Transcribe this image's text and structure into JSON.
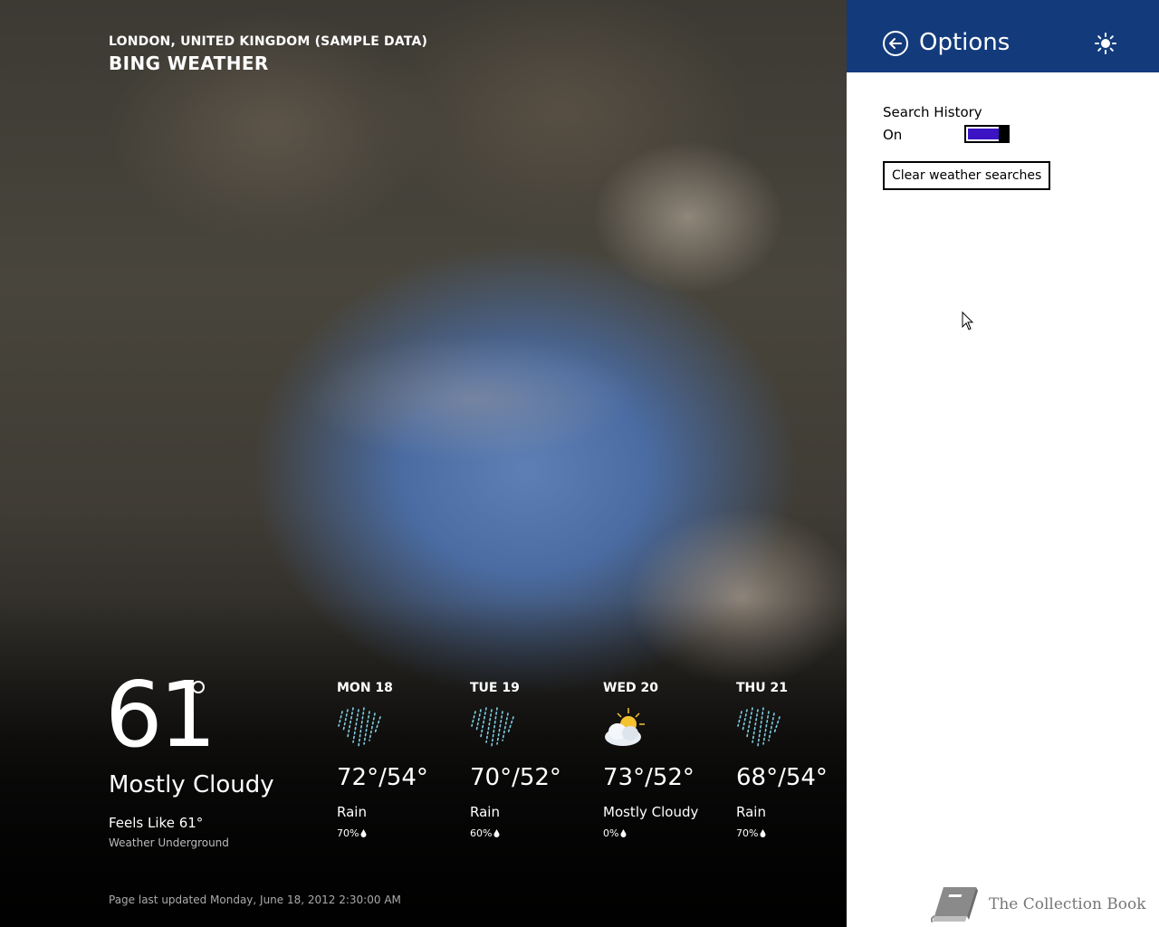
{
  "weather": {
    "location": "LONDON, UNITED KINGDOM (SAMPLE DATA)",
    "app_name": "BING WEATHER",
    "current": {
      "temperature": "61",
      "condition": "Mostly Cloudy",
      "feels_like": "Feels Like 61°",
      "source": "Weather Underground"
    },
    "forecast": [
      {
        "day": "MON 18",
        "temps": "72°/54°",
        "condition": "Rain",
        "precip": "70%",
        "icon": "rain-icon"
      },
      {
        "day": "TUE 19",
        "temps": "70°/52°",
        "condition": "Rain",
        "precip": "60%",
        "icon": "rain-icon"
      },
      {
        "day": "WED 20",
        "temps": "73°/52°",
        "condition": "Mostly Cloudy",
        "precip": "0%",
        "icon": "sun-cloud-icon"
      },
      {
        "day": "THU 21",
        "temps": "68°/54°",
        "condition": "Rain",
        "precip": "70%",
        "icon": "rain-icon"
      }
    ],
    "last_updated": "Page last updated Monday, June 18, 2012 2:30:00 AM"
  },
  "options": {
    "title": "Options",
    "search_history_label": "Search History",
    "search_history_state": "On",
    "search_history_on": true,
    "clear_button_label": "Clear weather searches",
    "header_color": "#133b7c",
    "toggle_color": "#3c14c4"
  },
  "watermark": {
    "text": "The Collection Book"
  }
}
